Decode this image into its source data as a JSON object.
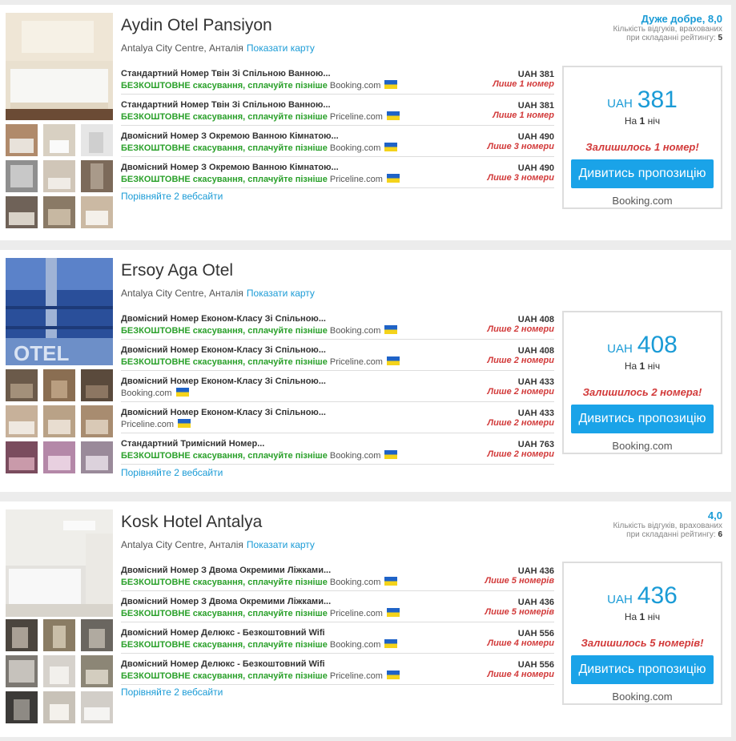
{
  "hotels": [
    {
      "name": "Aydin Otel Pansiyon",
      "location": "Antalya City Centre, Анталія",
      "map_link": "Показати карту",
      "rating": {
        "score": "Дуже добре, 8,0",
        "note_line1": "Кількість відгуків, врахованих",
        "note_line2": "при складанні рейтингу:",
        "count": "5"
      },
      "offers": [
        {
          "room": "Стандартний Номер Твін Зі Спільною Ванною...",
          "cancel": "БЕЗКОШТОВНЕ скасування, сплачуйте пізніше",
          "source": "Booking.com",
          "price": "UAH 381",
          "left": "Лише 1 номер"
        },
        {
          "room": "Стандартний Номер Твін Зі Спільною Ванною...",
          "cancel": "БЕЗКОШТОВНЕ скасування, сплачуйте пізніше",
          "source": "Priceline.com",
          "price": "UAH 381",
          "left": "Лише 1 номер"
        },
        {
          "room": "Двомісний Номер З Окремою Ванною Кімнатою...",
          "cancel": "БЕЗКОШТОВНЕ скасування, сплачуйте пізніше",
          "source": "Booking.com",
          "price": "UAH 490",
          "left": "Лише 3 номери"
        },
        {
          "room": "Двомісний Номер З Окремою Ванною Кімнатою...",
          "cancel": "БЕЗКОШТОВНЕ скасування, сплачуйте пізніше",
          "source": "Priceline.com",
          "price": "UAH 490",
          "left": "Лише 3 номери"
        }
      ],
      "compare": "Порівняйте 2 вебсайти",
      "deal": {
        "currency": "UAH",
        "amount": "381",
        "night_pre": "На",
        "night_num": "1",
        "night_post": "ніч",
        "remaining": "Залишилось 1 номер!",
        "button": "Дивитись пропозицію",
        "site": "Booking.com"
      }
    },
    {
      "name": "Ersoy Aga Otel",
      "location": "Antalya City Centre, Анталія",
      "map_link": "Показати карту",
      "offers": [
        {
          "room": "Двомісний Номер Економ-Класу Зі Спільною...",
          "cancel": "БЕЗКОШТОВНЕ скасування, сплачуйте пізніше",
          "source": "Booking.com",
          "price": "UAH 408",
          "left": "Лише 2 номери"
        },
        {
          "room": "Двомісний Номер Економ-Класу Зі Спільною...",
          "cancel": "БЕЗКОШТОВНЕ скасування, сплачуйте пізніше",
          "source": "Priceline.com",
          "price": "UAH 408",
          "left": "Лише 2 номери"
        },
        {
          "room": "Двомісний Номер Економ-Класу Зі Спільною...",
          "cancel": "",
          "source": "Booking.com",
          "price": "UAH 433",
          "left": "Лише 2 номери"
        },
        {
          "room": "Двомісний Номер Економ-Класу Зі Спільною...",
          "cancel": "",
          "source": "Priceline.com",
          "price": "UAH 433",
          "left": "Лише 2 номери"
        },
        {
          "room": "Стандартний Тримісний Номер...",
          "cancel": "БЕЗКОШТОВНЕ скасування, сплачуйте пізніше",
          "source": "Booking.com",
          "price": "UAH 763",
          "left": "Лише 2 номери"
        }
      ],
      "compare": "Порівняйте 2 вебсайти",
      "deal": {
        "currency": "UAH",
        "amount": "408",
        "night_pre": "На",
        "night_num": "1",
        "night_post": "ніч",
        "remaining": "Залишилось 2 номера!",
        "button": "Дивитись пропозицію",
        "site": "Booking.com"
      }
    },
    {
      "name": "Kosk Hotel Antalya",
      "location": "Antalya City Centre, Анталія",
      "map_link": "Показати карту",
      "rating": {
        "score": "4,0",
        "note_line1": "Кількість відгуків, врахованих",
        "note_line2": "при складанні рейтингу:",
        "count": "6"
      },
      "offers": [
        {
          "room": "Двомісний Номер З Двома Окремими Ліжками...",
          "cancel": "БЕЗКОШТОВНЕ скасування, сплачуйте пізніше",
          "source": "Booking.com",
          "price": "UAH 436",
          "left": "Лише 5 номерів"
        },
        {
          "room": "Двомісний Номер З Двома Окремими Ліжками...",
          "cancel": "БЕЗКОШТОВНЕ скасування, сплачуйте пізніше",
          "source": "Priceline.com",
          "price": "UAH 436",
          "left": "Лише 5 номерів"
        },
        {
          "room": "Двомісний Номер Делюкс - Безкоштовний Wifi",
          "cancel": "БЕЗКОШТОВНЕ скасування, сплачуйте пізніше",
          "source": "Booking.com",
          "price": "UAH 556",
          "left": "Лише 4 номери"
        },
        {
          "room": "Двомісний Номер Делюкс - Безкоштовний Wifi",
          "cancel": "БЕЗКОШТОВНЕ скасування, сплачуйте пізніше",
          "source": "Priceline.com",
          "price": "UAH 556",
          "left": "Лише 4 номери"
        }
      ],
      "compare": "Порівняйте 2 вебсайти",
      "deal": {
        "currency": "UAH",
        "amount": "436",
        "night_pre": "На",
        "night_num": "1",
        "night_post": "ніч",
        "remaining": "Залишилось 5 номерів!",
        "button": "Дивитись пропозицію",
        "site": "Booking.com"
      }
    }
  ]
}
